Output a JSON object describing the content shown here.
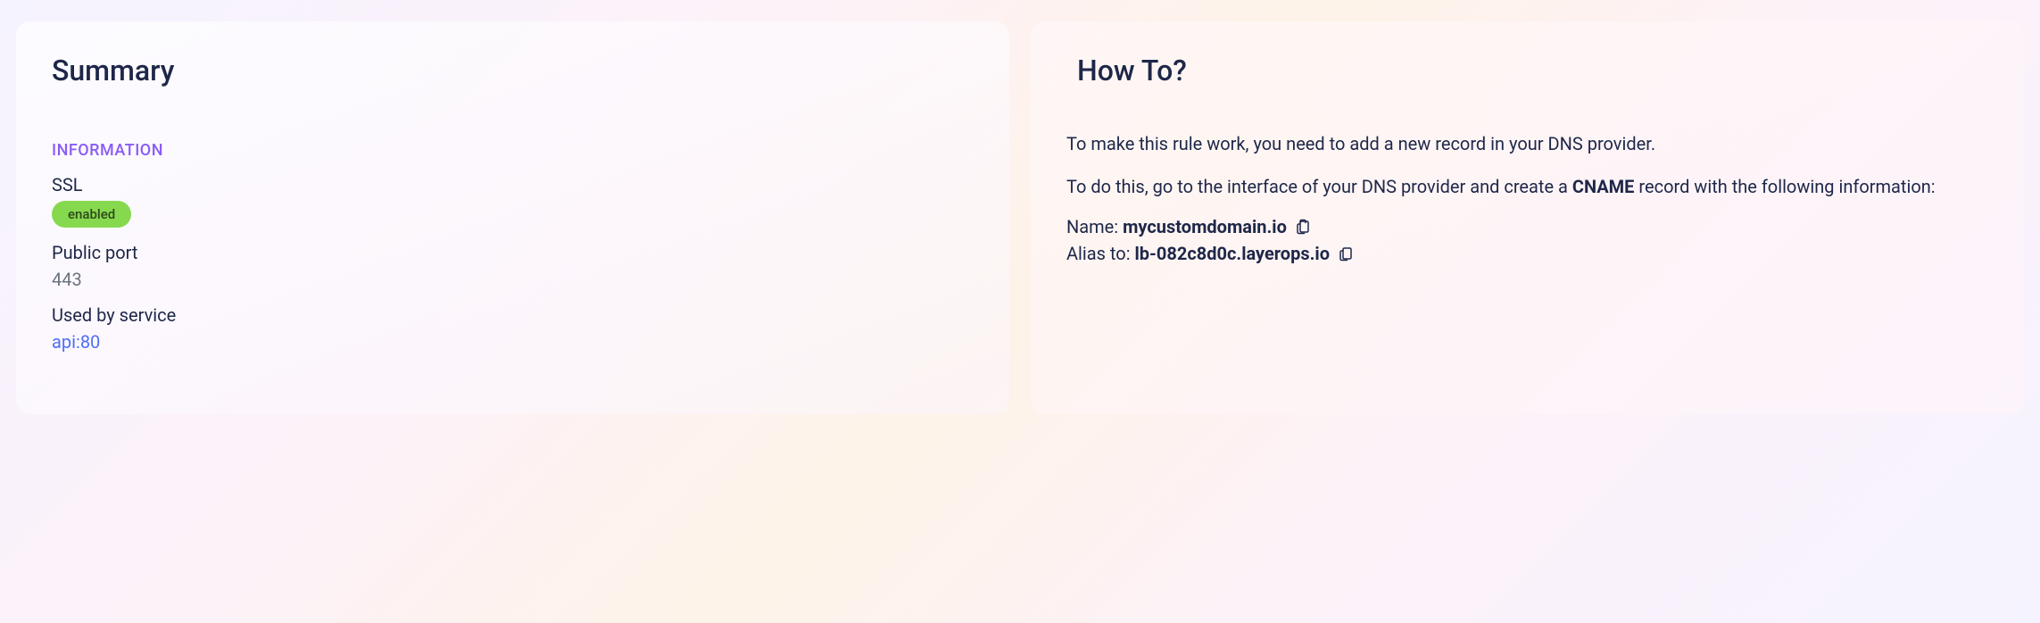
{
  "summary": {
    "title": "Summary",
    "section_header": "INFORMATION",
    "ssl_label": "SSL",
    "ssl_status": "enabled",
    "public_port_label": "Public port",
    "public_port_value": "443",
    "used_by_label": "Used by service",
    "used_by_value": "api:80"
  },
  "howto": {
    "title": "How To?",
    "intro": "To make this rule work, you need to add a new record in your DNS provider.",
    "instruction_prefix": "To do this, go to the interface of your DNS provider and create a ",
    "record_type": "CNAME",
    "instruction_suffix": " record with the following information:",
    "name_label": "Name: ",
    "name_value": "mycustomdomain.io",
    "alias_label": "Alias to: ",
    "alias_value": "lb-082c8d0c.layerops.io"
  }
}
